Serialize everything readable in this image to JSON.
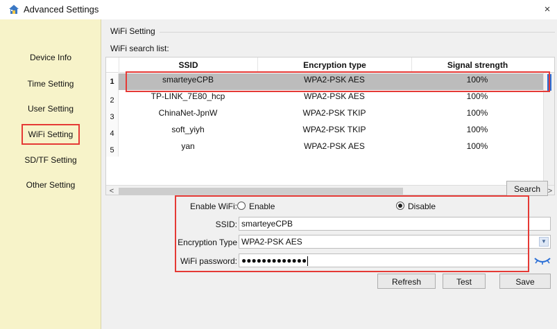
{
  "window": {
    "title": "Advanced Settings",
    "close_glyph": "×",
    "icon": "home-icon"
  },
  "sidebar": {
    "items": [
      {
        "label": "Device Info"
      },
      {
        "label": "Time Setting"
      },
      {
        "label": "User Setting"
      },
      {
        "label": "WiFi Setting",
        "active": true
      },
      {
        "label": "SD/TF Setting"
      },
      {
        "label": "Other Setting"
      }
    ]
  },
  "wifi": {
    "group_title": "WiFi Setting",
    "list_label": "WiFi search list:",
    "columns": [
      "SSID",
      "Encryption type",
      "Signal strength"
    ],
    "rows": [
      {
        "num": "1",
        "ssid": "smarteyeCPB",
        "enc": "WPA2-PSK AES",
        "signal": "100%",
        "selected": true
      },
      {
        "num": "2",
        "ssid": "TP-LINK_7E80_hcp",
        "enc": "WPA2-PSK AES",
        "signal": "100%"
      },
      {
        "num": "3",
        "ssid": "ChinaNet-JpnW",
        "enc": "WPA2-PSK TKIP",
        "signal": "100%"
      },
      {
        "num": "4",
        "ssid": "soft_yiyh",
        "enc": "WPA2-PSK TKIP",
        "signal": "100%"
      },
      {
        "num": "5",
        "ssid": "yan",
        "enc": "WPA2-PSK AES",
        "signal": "100%"
      }
    ],
    "scroll_left": "<",
    "scroll_right": ">",
    "search_label": "Search",
    "enable_label": "Enable WiFi:",
    "enable_option": "Enable",
    "disable_option": "Disable",
    "enabled": false,
    "ssid_label": "SSID:",
    "ssid_value": "smarteyeCPB",
    "encryption_label": "Encryption Type",
    "encryption_value": "WPA2-PSK AES",
    "password_label": "WiFi password:",
    "password_masked": "●●●●●●●●●●●●●",
    "refresh_label": "Refresh",
    "test_label": "Test",
    "save_label": "Save"
  },
  "colors": {
    "sidebar_bg": "#f7f3c9",
    "highlight": "#e53935",
    "selected_row": "#bcbcbc",
    "accent": "#2a6fd6"
  }
}
